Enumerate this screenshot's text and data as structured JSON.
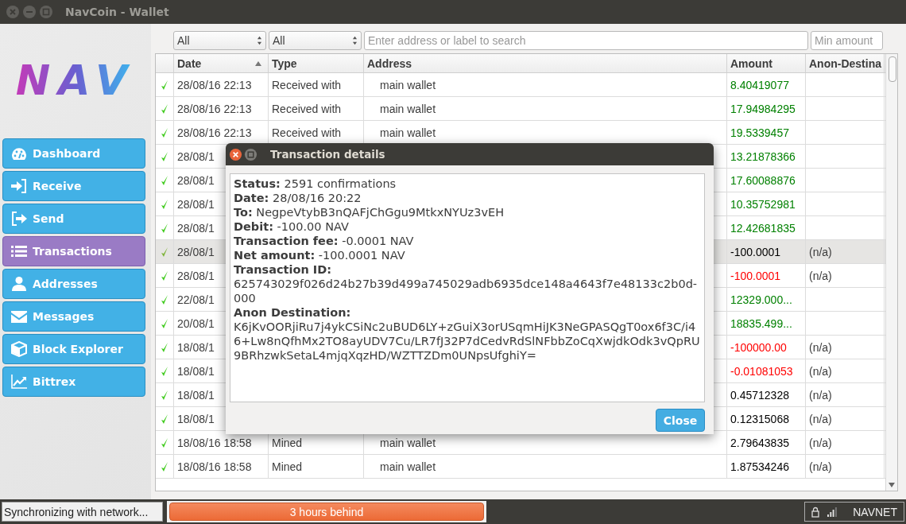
{
  "window": {
    "title": "NavCoin - Wallet"
  },
  "logo": "NAV",
  "sidebar": {
    "items": [
      {
        "label": "Dashboard",
        "selected": false
      },
      {
        "label": "Receive",
        "selected": false
      },
      {
        "label": "Send",
        "selected": false
      },
      {
        "label": "Transactions",
        "selected": true
      },
      {
        "label": "Addresses",
        "selected": false
      },
      {
        "label": "Messages",
        "selected": false
      },
      {
        "label": "Block Explorer",
        "selected": false
      },
      {
        "label": "Bittrex",
        "selected": false
      }
    ]
  },
  "filters": {
    "date": "All",
    "type": "All",
    "search": {
      "placeholder": "Enter address or label to search"
    },
    "min_amount": {
      "placeholder": "Min amount"
    }
  },
  "table": {
    "columns": [
      {
        "sorted": false
      },
      {
        "label": "Date",
        "sorted": true
      },
      {
        "label": "Type",
        "sorted": false
      },
      {
        "label": "Address",
        "sorted": false
      },
      {
        "label": "Amount",
        "sorted": false
      },
      {
        "label": "Anon-Destina",
        "sorted": false
      }
    ],
    "rows": [
      {
        "confirmed": true,
        "selected": false,
        "date": "28/08/16 22:13",
        "type": "Received with",
        "address": "main wallet",
        "amount": "8.40419077",
        "color": "#008000"
      },
      {
        "confirmed": true,
        "selected": false,
        "date": "28/08/16 22:13",
        "type": "Received with",
        "address": "main wallet",
        "amount": "17.94984295",
        "color": "#008000"
      },
      {
        "confirmed": true,
        "selected": false,
        "date": "28/08/16 22:13",
        "type": "Received with",
        "address": "main wallet",
        "amount": "19.5339457",
        "color": "#008000"
      },
      {
        "confirmed": true,
        "selected": false,
        "date": "28/08/1",
        "amount": "13.21878366",
        "color": "#008000"
      },
      {
        "confirmed": true,
        "selected": false,
        "date": "28/08/1",
        "amount": "17.60088876",
        "color": "#008000"
      },
      {
        "confirmed": true,
        "selected": false,
        "date": "28/08/1",
        "amount": "10.35752981",
        "color": "#008000"
      },
      {
        "confirmed": true,
        "selected": false,
        "date": "28/08/1",
        "amount": "12.42681835",
        "color": "#008000"
      },
      {
        "confirmed": true,
        "selected": true,
        "date": "28/08/1",
        "amount": "-100.0001",
        "color": "#000000",
        "anon": "(n/a)"
      },
      {
        "confirmed": true,
        "selected": false,
        "date": "28/08/1",
        "amount": "-100.0001",
        "color": "#ff0000",
        "anon": "(n/a)"
      },
      {
        "confirmed": true,
        "selected": false,
        "date": "22/08/1",
        "amount": "12329.000...",
        "color": "#008000"
      },
      {
        "confirmed": true,
        "selected": false,
        "date": "20/08/1",
        "amount": "18835.499...",
        "color": "#008000"
      },
      {
        "confirmed": true,
        "selected": false,
        "date": "18/08/1",
        "amount": "-100000.00",
        "color": "#ff0000",
        "anon": "(n/a)"
      },
      {
        "confirmed": true,
        "selected": false,
        "date": "18/08/1",
        "amount": "-0.01081053",
        "color": "#ff0000",
        "anon": "(n/a)"
      },
      {
        "confirmed": true,
        "selected": false,
        "date": "18/08/1",
        "amount": "0.45712328",
        "color": "#000000",
        "anon": "(n/a)"
      },
      {
        "confirmed": true,
        "selected": false,
        "date": "18/08/1",
        "amount": "0.12315068",
        "color": "#000000",
        "anon": "(n/a)"
      },
      {
        "confirmed": true,
        "selected": false,
        "date": "18/08/16 18:58",
        "type": "Mined",
        "address": "main wallet",
        "amount": "2.79643835",
        "color": "#000000",
        "anon": "(n/a)"
      },
      {
        "confirmed": true,
        "selected": false,
        "date": "18/08/16 18:58",
        "type": "Mined",
        "address": "main wallet",
        "amount": "1.87534246",
        "color": "#000000",
        "anon": "(n/a)"
      }
    ]
  },
  "dialog": {
    "title": "Transaction details",
    "details": [
      {
        "kind": "inline",
        "label": "Status:",
        "value": "2591 confirmations"
      },
      {
        "kind": "inline",
        "label": "Date:",
        "value": "28/08/16 20:22"
      },
      {
        "kind": "inline",
        "label": "To:",
        "value": "NegpeVtybB3nQAFjChGgu9MtkxNYUz3vEH"
      },
      {
        "kind": "inline",
        "label": "Debit:",
        "value": "-100.00 NAV"
      },
      {
        "kind": "inline",
        "label": "Transaction fee:",
        "value": "-0.0001 NAV"
      },
      {
        "kind": "inline",
        "label": "Net amount:",
        "value": "-100.0001 NAV"
      },
      {
        "kind": "block",
        "label": "Transaction ID:",
        "value": "625743029f026d24b27b39d499a745029adb6935dce148a4643f7e48133c2b0d-000"
      },
      {
        "kind": "block",
        "label": "Anon Destination:",
        "value": "K6jKvOORjiRu7j4ykCSiNc2uBUD6LY+zGuiX3orUSqmHiJK3NeGPASQgT0ox6f3C/i46+Lw8nQfhMx2TO8ayUDV7Cu/LR7fJ32P7dCedvRdSlNFbbZoCqXwjdkOdk3vQpRU9BRhzwkSetaL4mjqXqzHD/WZTTZDm0UNpsUfghiY="
      }
    ],
    "button": "Close"
  },
  "status_bar": {
    "sync": "Synchronizing with network...",
    "progress": {
      "label": "3 hours behind",
      "level": 1
    },
    "network": "NAVNET"
  }
}
